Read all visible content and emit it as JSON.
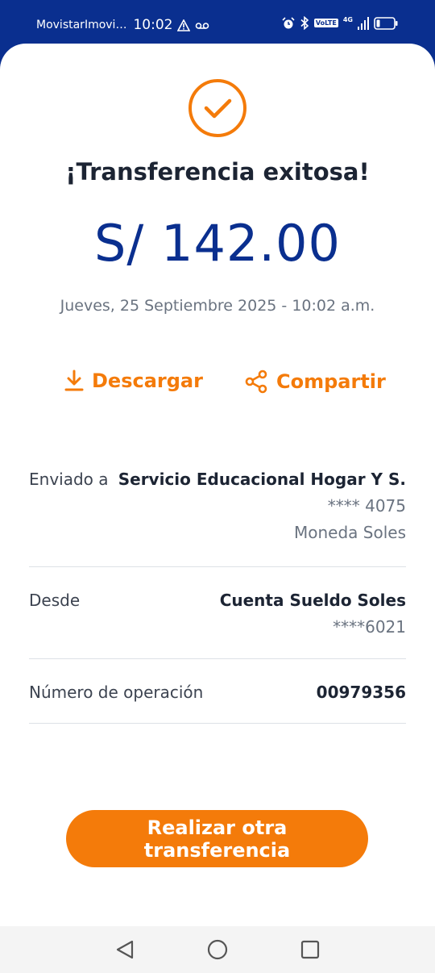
{
  "status_bar": {
    "carrier": "MovistarImovi…",
    "time": "10:02",
    "volte": "VoLTE",
    "network": "4G"
  },
  "result": {
    "title": "¡Transferencia exitosa!",
    "amount": "S/ 142.00",
    "datetime": "Jueves, 25 Septiembre 2025 - 10:02 a.m."
  },
  "actions": {
    "download_label": "Descargar",
    "share_label": "Compartir"
  },
  "details": {
    "sent_to": {
      "label": "Enviado a",
      "name": "Servicio Educacional Hogar Y S.",
      "account": "**** 4075",
      "currency": "Moneda Soles"
    },
    "from": {
      "label": "Desde",
      "account_name": "Cuenta Sueldo Soles",
      "account": "****6021"
    },
    "operation": {
      "label": "Número de operación",
      "number": "00979356"
    }
  },
  "primary_button": {
    "label": "Realizar otra transferencia"
  },
  "colors": {
    "brand_blue": "#0a2f8f",
    "accent_orange": "#f47b0a"
  }
}
